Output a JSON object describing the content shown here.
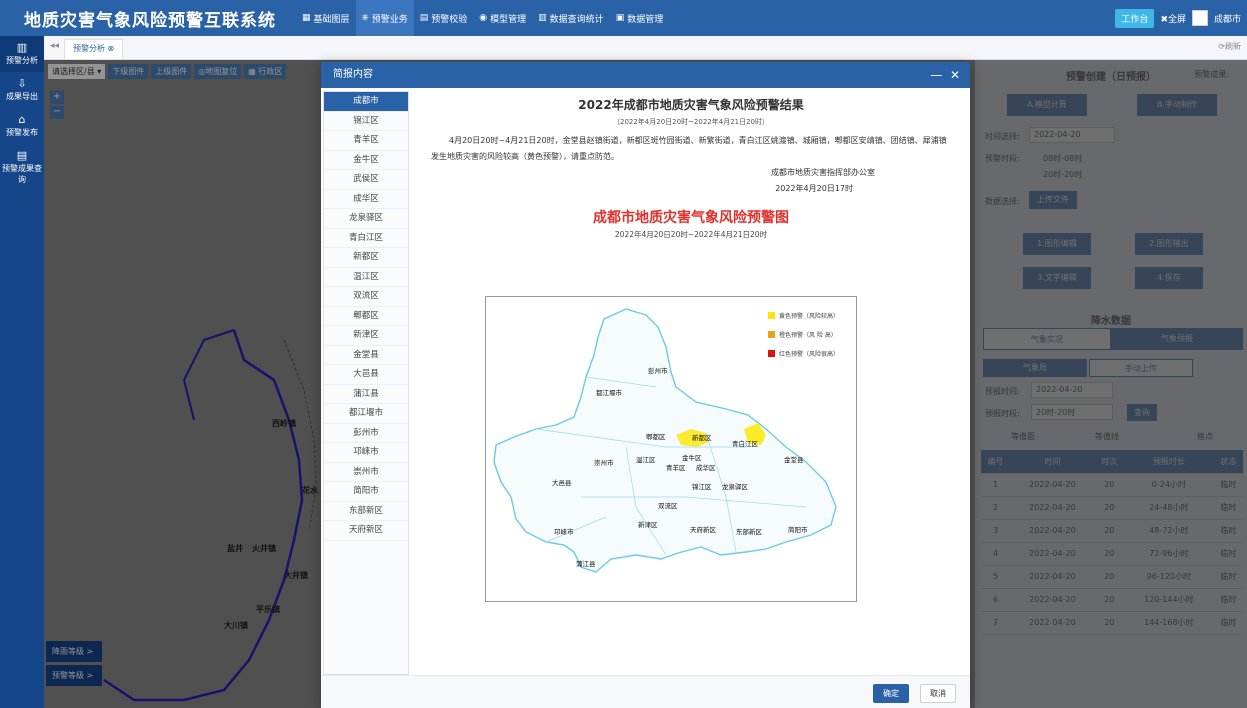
{
  "app": {
    "title": "地质灾害气象风险预警互联系统"
  },
  "nav": [
    {
      "icon": "▦",
      "label": "基础图层"
    },
    {
      "icon": "⎈",
      "label": "预警业务"
    },
    {
      "icon": "▤",
      "label": "预警校验"
    },
    {
      "icon": "◉",
      "label": "模型管理"
    },
    {
      "icon": "▥",
      "label": "数据查询统计"
    },
    {
      "icon": "▣",
      "label": "数据管理"
    }
  ],
  "topright": {
    "workbench": "工作台",
    "fullscreen": "✖全屏",
    "user": "成都市"
  },
  "sidebar": [
    {
      "icon": "▥",
      "label": "预警分析"
    },
    {
      "icon": "⇩",
      "label": "成果导出"
    },
    {
      "icon": "⌂",
      "label": "预警发布"
    },
    {
      "icon": "▤",
      "label": "预警成果查询"
    }
  ],
  "tabs": {
    "active": "预警分析 ⊗",
    "refresh": "⟳刷新"
  },
  "maptoolbar": [
    "请选择区/县 ▾",
    "下级图件",
    "上级图件",
    "◎地图复位",
    "▦ 行政区"
  ],
  "mapTowns": [
    "西岭镇",
    "花水",
    "盐井",
    "火井镇",
    "大井镇",
    "平乐镇",
    "大川镇"
  ],
  "mapLegend": {
    "rain": "降雨等级 >",
    "warn": "预警等级 >"
  },
  "rightPanel": {
    "title": "预警创建（日预报）",
    "result": "预警成果:",
    "btnModel": "A.模型计算",
    "btnManual": "B.手动制作",
    "timeLabel": "时间选择:",
    "timeValue": "2022-04-20",
    "periodLabel": "预警时段:",
    "period1": "08时-08时",
    "period2": "20时-20时",
    "dataLabel": "数据选择:",
    "upload": "上传文件",
    "b1": "1.图形编辑",
    "b2": "2.图形输出",
    "b3": "3.文字编辑",
    "b4": "4.保存",
    "rainTitle": "降水数据",
    "tab1": "气象实况",
    "tab2": "气象预报",
    "sub1": "气象局",
    "sub2": "手动上传",
    "fcTimeLabel": "预报时间:",
    "fcTime": "2022-04-20",
    "fcPeriodLabel": "预报时段:",
    "fcPeriod": "20时-20时",
    "query": "查询",
    "chk1": "等值面",
    "chk2": "等值线",
    "chk3": "格点",
    "headers": [
      "编号",
      "时间",
      "时次",
      "预报时长",
      "状态"
    ],
    "rows": [
      [
        "1",
        "2022-04-20",
        "20",
        "0-24小时",
        "临时"
      ],
      [
        "2",
        "2022-04-20",
        "20",
        "24-48小时",
        "临时"
      ],
      [
        "3",
        "2022-04-20",
        "20",
        "48-72小时",
        "临时"
      ],
      [
        "4",
        "2022-04-20",
        "20",
        "72-96小时",
        "临时"
      ],
      [
        "5",
        "2022-04-20",
        "20",
        "96-120小时",
        "临时"
      ],
      [
        "6",
        "2022-04-20",
        "20",
        "120-144小时",
        "临时"
      ],
      [
        "7",
        "2022-04-20",
        "20",
        "144-168小时",
        "临时"
      ]
    ]
  },
  "modal": {
    "title": "简报内容",
    "districts": [
      "成都市",
      "锦江区",
      "青羊区",
      "金牛区",
      "武侯区",
      "成华区",
      "龙泉驿区",
      "青白江区",
      "新都区",
      "温江区",
      "双流区",
      "郫都区",
      "新津区",
      "金堂县",
      "大邑县",
      "蒲江县",
      "都江堰市",
      "彭州市",
      "邛崃市",
      "崇州市",
      "简阳市",
      "东部新区",
      "天府新区"
    ],
    "docTitle": "2022年成都市地质灾害气象风险预警结果",
    "docSub": "（2022年4月20日20时~2022年4月21日20时）",
    "docBody": "4月20日20时~4月21日20时，金堂县赵镇街道，新都区斑竹园街道、新繁街道，青白江区姚渡镇、城厢镇，郫都区安靖镇、团结镇、犀浦镇发生地质灾害的风险较高（黄色预警），请重点防范。",
    "signOrg": "成都市地质灾害指挥部办公室",
    "signDate": "2022年4月20日17时",
    "mapTitle": "成都市地质灾害气象风险预警图",
    "mapSub": "2022年4月20日20时~2022年4月21日20时",
    "legend": [
      {
        "label": "黄色预警（风险较高）",
        "color": "#ffe600"
      },
      {
        "label": "橙色预警（风 险 高）",
        "color": "#e8a21a"
      },
      {
        "label": "红色预警（风险很高）",
        "color": "#e01010"
      }
    ],
    "mapLabels": [
      "彭州市",
      "都江堰市",
      "郫都区",
      "新都区",
      "青白江区",
      "崇州市",
      "温江区",
      "金牛区",
      "青羊区",
      "成华区",
      "金堂县",
      "大邑县",
      "锦江区",
      "龙泉驿区",
      "双流区",
      "邛崃市",
      "新津区",
      "天府新区",
      "东部新区",
      "简阳市",
      "蒲江县"
    ],
    "ok": "确定",
    "cancel": "取消"
  }
}
